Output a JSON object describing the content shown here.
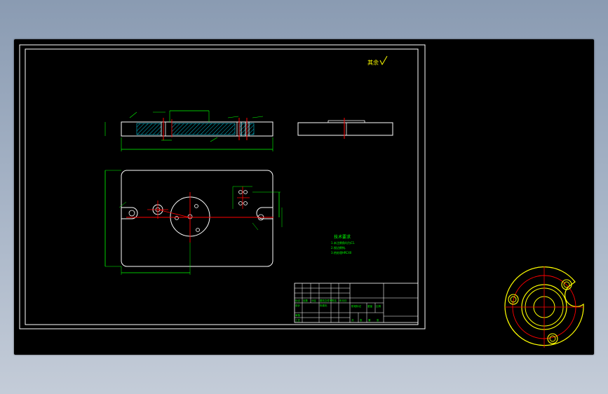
{
  "drawing": {
    "roughness_mark": "其余",
    "tech_req_title": "技术要求",
    "tech_req_lines": [
      "1.未注倒角均为C1.",
      "2.锐边倒钝.",
      "3.热处理HRC40"
    ],
    "title_block": {
      "row_labels": [
        "标记",
        "处数",
        "分区",
        "更改文件号",
        "签名",
        "年月日"
      ],
      "design_label": "设计",
      "review_label": "审核",
      "process_label": "工艺",
      "std_label": "标准化",
      "stage_label": "阶段标记",
      "weight_label": "重量",
      "scale_label": "比例",
      "sheet_labels": [
        "共",
        "张",
        "第",
        "张"
      ]
    }
  },
  "colors": {
    "frame": "#ffffff",
    "dimension": "#00ff00",
    "centerline": "#ff0000",
    "hatch": "#00ffff",
    "annotation": "#ffff00",
    "background": "#000000"
  }
}
